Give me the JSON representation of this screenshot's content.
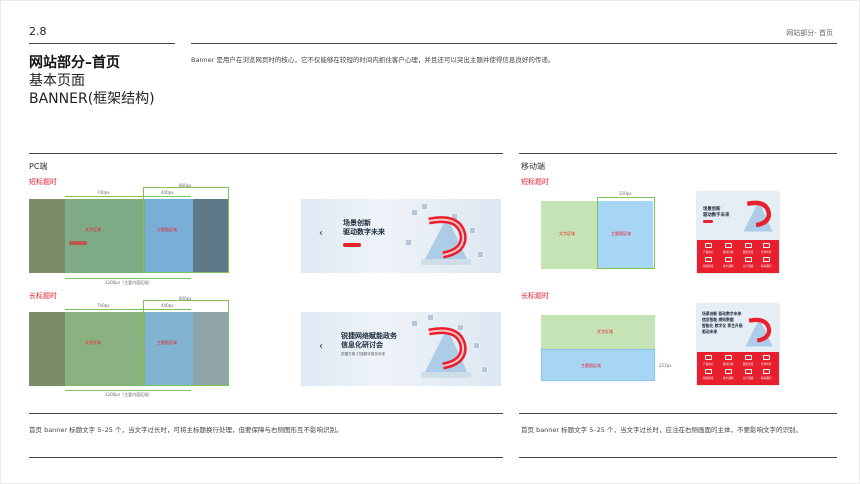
{
  "header": {
    "section_number": "2.8",
    "section_label": "网站部分- 首页",
    "title_line1": "网站部分–首页",
    "title_line2": "基本页面",
    "title_line3": "BANNER(框架结构)",
    "description": "Banner 是用户在浏览网页时的核心，它不仅能够在较短的时间内抓住客户心理，并且还可以突出主题并使得信息良好的传递。"
  },
  "pc": {
    "section_title": "PC端",
    "short_title_label": "短标题时",
    "long_title_label": "长标题时",
    "dim_740": "740px",
    "dim_800": "800px",
    "dim_440": "440px",
    "dim_1200": "1200px（主要内容区域）",
    "text_zone_label": "文字区域",
    "main_zone_label": "主题图区域",
    "short_banner_title_1": "场景创新",
    "short_banner_title_2": "驱动数字未来",
    "long_banner_title_1": "锐捷网络赋能政务",
    "long_banner_title_2": "信息化研讨会",
    "long_banner_sub": "锐捷方案 打造数字政务未来",
    "note": "首页 banner 标题文字 5–25 个，当文字过长时，可将主标题换行处理，但要保障与右侧图形互不影响识别。"
  },
  "mobile": {
    "section_title": "移动端",
    "short_title_label": "短标题时",
    "long_title_label": "长标题时",
    "dim_320": "320px",
    "dim_222": "222px",
    "text_zone_label": "文字区域",
    "main_zone_label": "主题图区域",
    "card_short_title_1": "场景创新",
    "card_short_title_2": "驱动数字未来",
    "card_long_title_1": "场景创新 驱动数字未来",
    "card_long_title_2": "信息智能 感知数据",
    "card_long_title_3": "智能化 数字化 孪生升级",
    "card_long_title_4": "驱动未来",
    "icon_labels": [
      "产品中心",
      "解决方案",
      "服务支持",
      "合作伙伴",
      "新闻资讯",
      "客户案例",
      "关于锐捷",
      "联系我们"
    ],
    "note": "首页 banner 标题文字 5–25 个，当文字过长时，应注在右侧画面的主体，不要影响文字的识别。"
  },
  "colors": {
    "accent_red": "#e8202e",
    "zone_green": "#9dcf7e",
    "zone_blue": "#84c3f0"
  }
}
